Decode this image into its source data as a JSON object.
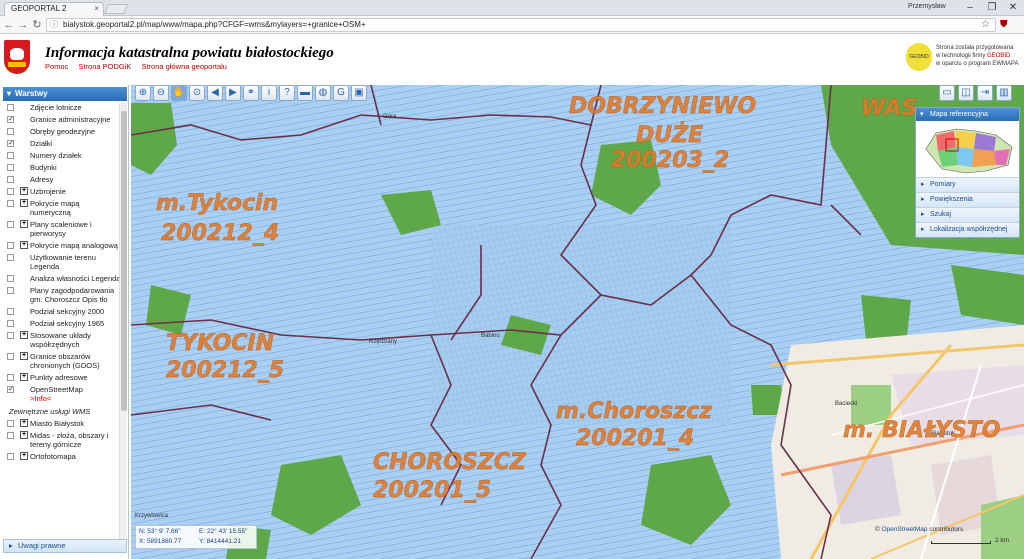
{
  "browser": {
    "tab_title": "GEOPORTAL 2",
    "user": "Przemysław",
    "url": "bialystok.geoportal2.pl/map/www/mapa.php?CFGF=wms&mylayers=+granice+OSM+"
  },
  "header": {
    "title": "Informacja katastralna powiatu białostockiego",
    "links": [
      "Pomoc",
      "Strona PODGiK",
      "Strona główna geoportalu"
    ],
    "geobid_logo": "GEOBID",
    "geobid_text_1": "Strona została przygotowana",
    "geobid_text_2": "w technologii firmy",
    "geobid_brand": "GEOBID",
    "geobid_text_3": "w oparciu o program EWMAPA"
  },
  "sidebar": {
    "title": "Warstwy",
    "layers": [
      {
        "label": "Zdjęcie lotnicze",
        "checked": false,
        "expandable": false
      },
      {
        "label": "Granice administracyjne",
        "checked": true,
        "expandable": false
      },
      {
        "label": "Obręby geodezyjne",
        "checked": false,
        "expandable": false
      },
      {
        "label": "Działki",
        "checked": true,
        "expandable": false
      },
      {
        "label": "Numery działek",
        "checked": false,
        "expandable": false
      },
      {
        "label": "Budynki",
        "checked": false,
        "expandable": false
      },
      {
        "label": "Adresy",
        "checked": false,
        "expandable": false
      },
      {
        "label": "Uzbrojenie",
        "checked": false,
        "expandable": true
      },
      {
        "label": "Pokrycie mapą numeryczną",
        "checked": false,
        "expandable": true
      },
      {
        "label": "Plany scaleniowe i pierworysy",
        "checked": false,
        "expandable": true
      },
      {
        "label": "Pokrycie mapą analogową",
        "checked": false,
        "expandable": true
      },
      {
        "label": "Użytkowanie terenu Legenda",
        "checked": false,
        "expandable": false
      },
      {
        "label": "Analiza własności Legenda",
        "checked": false,
        "expandable": false
      },
      {
        "label": "Plany zagodpodarowania gm. Choroszcz Opis tło",
        "checked": false,
        "expandable": false
      },
      {
        "label": "Podział sekcyjny 2000",
        "checked": false,
        "expandable": false
      },
      {
        "label": "Podział sekcyjny 1965",
        "checked": false,
        "expandable": false
      },
      {
        "label": "Stosowane układy współrzędnych",
        "checked": false,
        "expandable": true
      },
      {
        "label": "Granice obszarów chronionych (GDOS)",
        "checked": false,
        "expandable": true
      },
      {
        "label": "Punkty adresowe",
        "checked": false,
        "expandable": true
      },
      {
        "label": "OpenStreetMap",
        "checked": true,
        "expandable": false,
        "info": ">Info<"
      }
    ],
    "external_title": "Zewnętrzne usługi WMS",
    "external": [
      {
        "label": "Miasto Białystok"
      },
      {
        "label": "Midas - złoża, obszary i tereny górnicze"
      },
      {
        "label": "Ortofotomapa"
      }
    ],
    "footer": "Uwagi prawne"
  },
  "map": {
    "labels": [
      {
        "text": "DOBRZYNIEWO",
        "id": "lbl-dobrzyniewo"
      },
      {
        "text": "DUŻE",
        "id": "lbl-duze"
      },
      {
        "text": "200203_2",
        "id": "lbl-200203"
      },
      {
        "text": "WAS",
        "id": "lbl-was"
      },
      {
        "text": "m.Tykocin",
        "id": "lbl-mtykocin"
      },
      {
        "text": "200212_4",
        "id": "lbl-2002124"
      },
      {
        "text": "TYKOCIN",
        "id": "lbl-tykocin"
      },
      {
        "text": "200212_5",
        "id": "lbl-2002125"
      },
      {
        "text": "m.Choroszcz",
        "id": "lbl-mchoroszcz"
      },
      {
        "text": "200201_4",
        "id": "lbl-2002014"
      },
      {
        "text": "CHOROSZCZ",
        "id": "lbl-choroszcz"
      },
      {
        "text": "200201_5",
        "id": "lbl-2002015"
      },
      {
        "text": "m. BIAŁYSTO",
        "id": "lbl-bialystok"
      }
    ],
    "places": [
      "Góra",
      "Baciecki",
      "Białystok",
      "Krzywlowica",
      "Rzędziany",
      "Babino"
    ],
    "reference_panel_title": "Mapa referencyjna",
    "panel_items": [
      "Pomiary",
      "Powiększenia",
      "Szukaj",
      "Lokalizacja współrzędnej"
    ],
    "coords": {
      "n": "N:  53° 9' 7.66\"",
      "e": "E:  22° 43' 15.55\"",
      "x": "X:  5891860.77",
      "y": "Y:  8414441.21"
    },
    "attribution_prefix": "©",
    "attribution_osm": "OpenStreetMap",
    "attribution_suffix": "contributors",
    "scale": "2 km",
    "colors": {
      "parcels": "#9cc6ee",
      "forest": "#5fa84a",
      "label": "#e07a2a",
      "boundary": "#6b2f4a"
    }
  }
}
